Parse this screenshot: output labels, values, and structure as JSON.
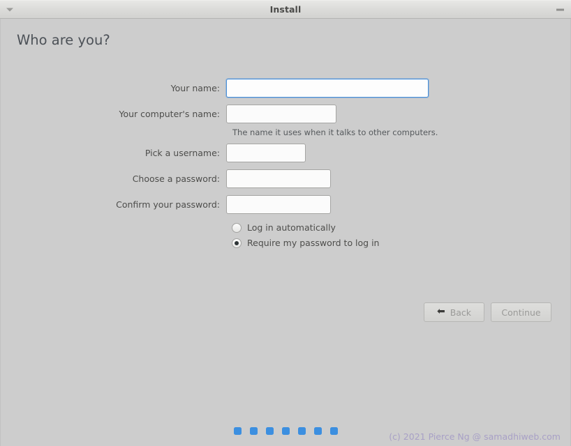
{
  "window": {
    "title": "Install",
    "menu_icon": "chevron-down-icon",
    "minimize_icon": "minimize-icon"
  },
  "page": {
    "heading": "Who are you?"
  },
  "form": {
    "fields": [
      {
        "label": "Your name:",
        "value": "",
        "placeholder": "",
        "focused": true,
        "width": "w-wide",
        "type": "text"
      },
      {
        "label": "Your computer's name:",
        "value": "",
        "placeholder": "",
        "focused": false,
        "width": "w-medium",
        "type": "text"
      },
      {
        "label": "Pick a username:",
        "value": "",
        "placeholder": "",
        "focused": false,
        "width": "w-small",
        "type": "text"
      },
      {
        "label": "Choose a password:",
        "value": "",
        "placeholder": "",
        "focused": false,
        "width": "w-pass",
        "type": "password"
      },
      {
        "label": "Confirm your password:",
        "value": "",
        "placeholder": "",
        "focused": false,
        "width": "w-pass",
        "type": "password"
      }
    ],
    "helper_text": "The name it uses when it talks to other computers."
  },
  "login_options": {
    "automatic": {
      "label": "Log in automatically",
      "selected": false
    },
    "require_password": {
      "label": "Require my password to log in",
      "selected": true
    }
  },
  "buttons": {
    "back": {
      "label": "Back",
      "icon": "arrow-left-icon",
      "glyph": "⬅",
      "disabled": true
    },
    "continue": {
      "label": "Continue",
      "disabled": true
    }
  },
  "progress": {
    "total_steps": 7,
    "dot_color": "#3c8fe0"
  },
  "watermark": {
    "text": "(c) 2021 Pierce Ng @ samadhiweb.com",
    "color": "#a8a0c6"
  }
}
